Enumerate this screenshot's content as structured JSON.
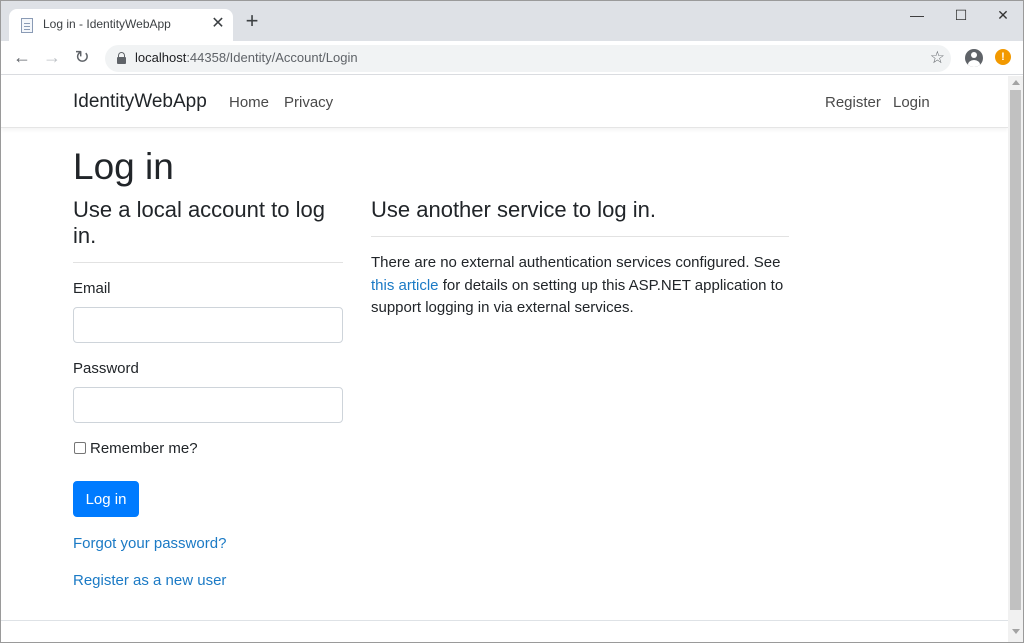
{
  "browser": {
    "tab_title": "Log in - IdentityWebApp",
    "tab_close": "✕",
    "new_tab": "+",
    "window_controls": {
      "minimize": "—",
      "maximize": "☐",
      "close": "✕"
    },
    "url_host": "localhost",
    "url_rest": ":44358/Identity/Account/Login",
    "nav": {
      "back": "←",
      "forward": "→",
      "reload": "↻"
    },
    "star": "☆",
    "alert": "!"
  },
  "navbar": {
    "brand": "IdentityWebApp",
    "links": [
      "Home",
      "Privacy"
    ],
    "right_links": [
      "Register",
      "Login"
    ]
  },
  "page": {
    "title": "Log in",
    "local": {
      "heading": "Use a local account to log in.",
      "email_label": "Email",
      "email_value": "",
      "password_label": "Password",
      "password_value": "",
      "remember_label": "Remember me?",
      "submit_label": "Log in",
      "forgot_link": "Forgot your password?",
      "register_link": "Register as a new user"
    },
    "external": {
      "heading": "Use another service to log in.",
      "text_before": "There are no external authentication services configured. See ",
      "link_text": "this article",
      "text_after": " for details on setting up this ASP.NET application to support logging in via external services."
    }
  },
  "colors": {
    "primary": "#007bff",
    "link": "#1b7ac5",
    "text": "#212529",
    "chrome": "#dee1e6"
  }
}
